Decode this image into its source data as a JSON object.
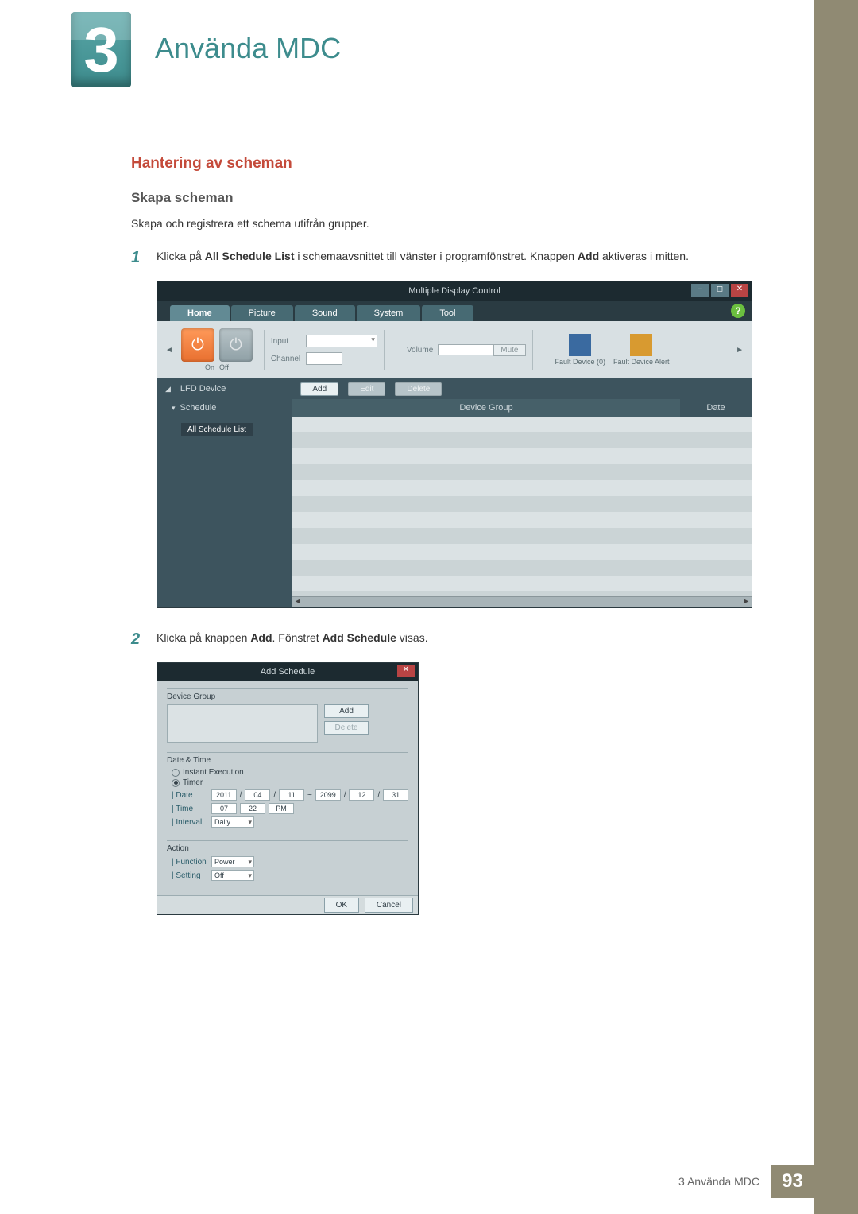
{
  "chapter": {
    "number": "3",
    "title": "Använda MDC"
  },
  "headings": {
    "red": "Hantering av scheman",
    "grey": "Skapa scheman"
  },
  "para1": "Skapa och registrera ett schema utifrån grupper.",
  "step1": {
    "num": "1",
    "pre": "Klicka på ",
    "b1": "All Schedule List",
    "mid": " i schemaavsnittet till vänster i programfönstret. Knappen ",
    "b2": "Add",
    "post": " aktiveras i mitten."
  },
  "step2": {
    "num": "2",
    "pre": "Klicka på knappen ",
    "b1": "Add",
    "mid": ". Fönstret ",
    "b2": "Add Schedule",
    "post": " visas."
  },
  "mdc": {
    "title": "Multiple Display Control",
    "tabs": {
      "home": "Home",
      "picture": "Picture",
      "sound": "Sound",
      "system": "System",
      "tool": "Tool"
    },
    "help": "?",
    "power": {
      "on": "On",
      "off": "Off"
    },
    "input": "Input",
    "channel": "Channel",
    "volume": "Volume",
    "mute": "Mute",
    "fault0": "Fault Device (0)",
    "faultAlert": "Fault Device Alert",
    "lfd": "LFD Device",
    "btnAdd": "Add",
    "btnEdit": "Edit",
    "btnDelete": "Delete",
    "schedule": "Schedule",
    "deviceGroup": "Device Group",
    "date": "Date",
    "allScheduleList": "All Schedule List"
  },
  "dlg": {
    "title": "Add Schedule",
    "deviceGroup": "Device Group",
    "add": "Add",
    "delete": "Delete",
    "dateTime": "Date & Time",
    "instant": "Instant Execution",
    "timer": "Timer",
    "dateLbl": "Date",
    "timeLbl": "Time",
    "intervalLbl": "Interval",
    "date": {
      "y1": "2011",
      "m1": "04",
      "d1": "11",
      "sep": "~",
      "y2": "2099",
      "m2": "12",
      "d2": "31"
    },
    "time": {
      "h": "07",
      "m": "22",
      "ap": "PM"
    },
    "interval": "Daily",
    "action": "Action",
    "functionLbl": "Function",
    "settingLbl": "Setting",
    "function": "Power",
    "setting": "Off",
    "ok": "OK",
    "cancel": "Cancel"
  },
  "footer": {
    "label": "3 Använda MDC",
    "page": "93"
  }
}
